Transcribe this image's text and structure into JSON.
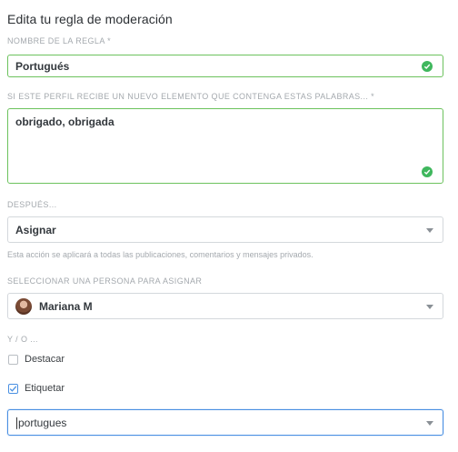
{
  "page": {
    "title": "Edita tu regla de moderación"
  },
  "rule_name": {
    "label": "NOMBRE DE LA REGLA *",
    "value": "Portugués"
  },
  "keywords": {
    "label": "SI ESTE PERFIL RECIBE UN NUEVO ELEMENTO QUE CONTENGA ESTAS PALABRAS... *",
    "value": "obrigado, obrigada"
  },
  "after": {
    "label": "DESPUÉS...",
    "value": "Asignar",
    "help": "Esta acción se aplicará a todas las publicaciones, comentarios y mensajes privados."
  },
  "assign": {
    "label": "SELECCIONAR UNA PERSONA PARA ASIGNAR",
    "value": "Mariana M"
  },
  "and_or": {
    "label": "Y / O ..."
  },
  "options": {
    "highlight": {
      "label": "Destacar",
      "checked": false
    },
    "tag": {
      "label": "Etiquetar",
      "checked": true
    }
  },
  "tag_input": {
    "value": "portugues"
  },
  "colors": {
    "valid": "#6cc25d",
    "focus": "#4a90e2",
    "label": "#a4a9ae"
  }
}
